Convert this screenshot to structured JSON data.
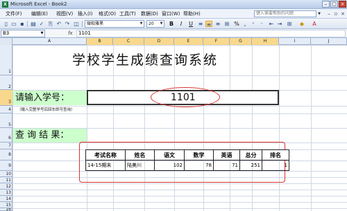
{
  "window": {
    "title": "Microsoft Excel - Book2"
  },
  "menu": {
    "items": [
      "文件(F)",
      "编辑(E)",
      "视图(V)",
      "插入(I)",
      "格式(O)",
      "工具(T)",
      "数据(D)",
      "窗口(W)",
      "帮助(H)"
    ],
    "help_placeholder": "键入需要帮助的问题"
  },
  "toolbar": {
    "font_name": "微软雅黑",
    "font_size": "20",
    "bold": "B",
    "italic": "I",
    "underline": "U",
    "percent": "%",
    "comma": ","
  },
  "formula_bar": {
    "name_box": "B3",
    "fx": "fx",
    "value": "1101"
  },
  "columns": [
    "A",
    "B",
    "C",
    "D",
    "E",
    "F",
    "G",
    "H",
    "I",
    "J"
  ],
  "rows": [
    "1",
    "2",
    "3",
    "4",
    "5",
    "6",
    "7",
    "8",
    "9",
    "10",
    "11",
    "12",
    "13",
    "14",
    "15",
    "16"
  ],
  "sheet": {
    "title": "学校学生成绩查询系统",
    "input_label": "请输入学号：",
    "input_value": "1101",
    "hint": "（输入完整学号后回车即可查询）",
    "result_label": "查 询 结 果："
  },
  "results_table": {
    "headers": [
      "考试名称",
      "姓名",
      "语文",
      "数学",
      "英语",
      "总分",
      "排名"
    ],
    "rows": [
      [
        "14-15期末",
        "陆美川",
        "102",
        "78",
        "71",
        "251",
        "1"
      ]
    ]
  },
  "colors": {
    "highlight_ellipse": "#d9322b",
    "label_fill": "#ccffcc",
    "selected_header": "#f8d88d"
  }
}
